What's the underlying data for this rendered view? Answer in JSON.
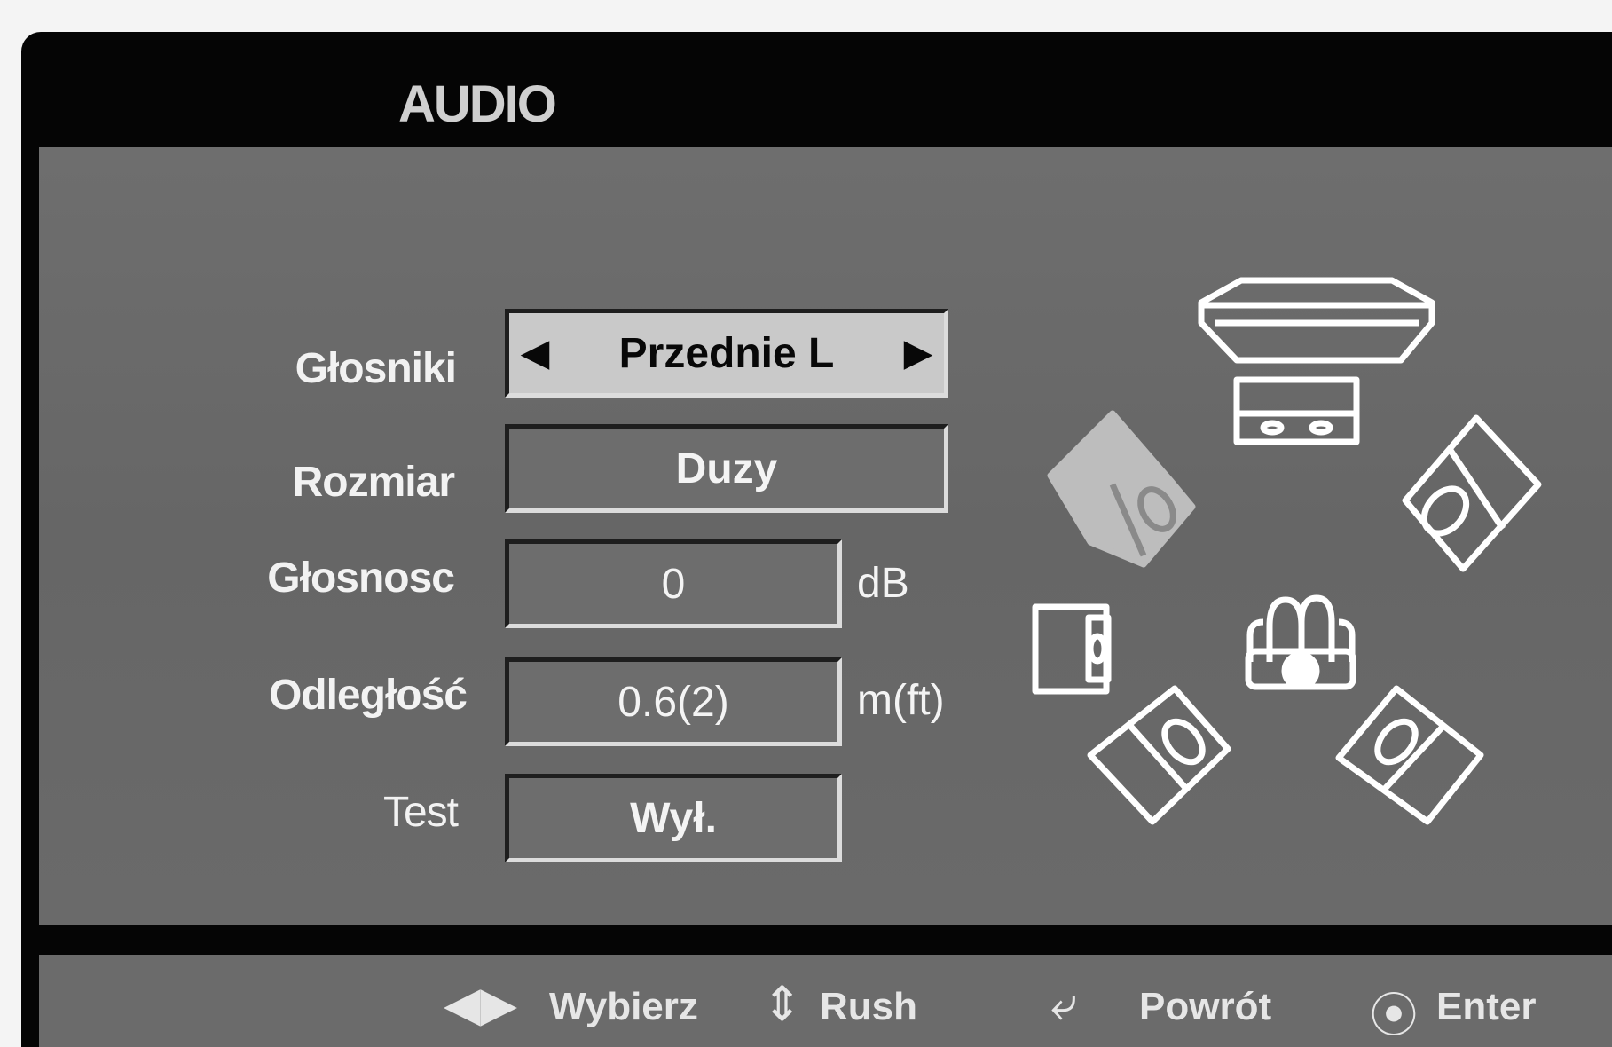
{
  "menu": {
    "title": "AUDIO"
  },
  "settings": {
    "speakers_label": "Głosniki",
    "speakers_value": "Przednie L",
    "size_label": "Rozmiar",
    "size_value": "Duzy",
    "volume_label": "Głosnosc",
    "volume_value": "0",
    "volume_unit": "dB",
    "distance_label": "Odległość",
    "distance_value": "0.6(2)",
    "distance_unit": "m(ft)",
    "test_label": "Test",
    "test_value": "Wył."
  },
  "footer": {
    "select_label": "Wybierz",
    "move_label": "Rush",
    "return_label": "Powrót",
    "enter_label": "Enter"
  },
  "icons": {
    "left_arrow": "◀",
    "right_arrow": "▶",
    "left_right": "◀▶",
    "up_down": "⇕",
    "return": "⤶",
    "enter": "⦿"
  },
  "colors": {
    "screen_bg": "#050505",
    "panel_bg": "#6b6b6b",
    "selected_bg": "#c9c9c9",
    "text": "#f2f2f2"
  }
}
